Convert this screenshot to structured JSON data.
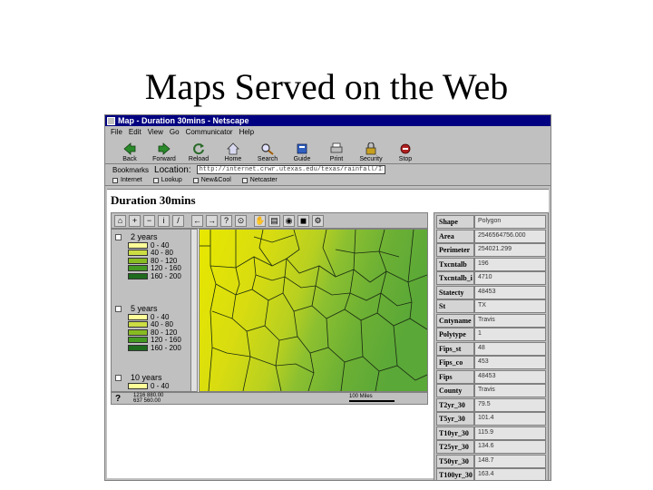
{
  "slide": {
    "title": "Maps Served on the Web"
  },
  "window": {
    "title": "Map - Duration 30mins - Netscape"
  },
  "menu": [
    "File",
    "Edit",
    "View",
    "Go",
    "Communicator",
    "Help"
  ],
  "toolbar": [
    {
      "label": "Back",
      "icon": "back-arrow-icon"
    },
    {
      "label": "Forward",
      "icon": "forward-arrow-icon"
    },
    {
      "label": "Reload",
      "icon": "reload-icon"
    },
    {
      "label": "Home",
      "icon": "home-icon"
    },
    {
      "label": "Search",
      "icon": "search-icon"
    },
    {
      "label": "Guide",
      "icon": "guide-icon"
    },
    {
      "label": "Print",
      "icon": "printer-icon"
    },
    {
      "label": "Security",
      "icon": "lock-icon"
    },
    {
      "label": "Stop",
      "icon": "stop-icon"
    }
  ],
  "location": {
    "bookmarks_label": "Bookmarks",
    "label": "Location:",
    "url": "http://internet.crwr.utexas.edu/texas/rainfall/IDF.htm"
  },
  "personal_toolbar": [
    "Internet",
    "Lookup",
    "New&Cool",
    "Netcaster"
  ],
  "page": {
    "heading": "Duration 30mins"
  },
  "map_tools": [
    "⌂",
    "+",
    "−",
    "i",
    "/",
    "←",
    "→",
    "?",
    "⊙",
    "✋",
    "▤",
    "◉",
    "◼",
    "⚙"
  ],
  "legend": {
    "colors": [
      "#ffff99",
      "#ccdd44",
      "#88bb22",
      "#449922",
      "#1e6b1e"
    ],
    "groups": [
      {
        "title": "2 years",
        "ranges": [
          "0 - 40",
          "40 - 80",
          "80 - 120",
          "120 - 160",
          "160 - 200"
        ]
      },
      {
        "title": "5 years",
        "ranges": [
          "0 - 40",
          "40 - 80",
          "80 - 120",
          "120 - 160",
          "160 - 200"
        ]
      },
      {
        "title": "10 years",
        "ranges": [
          "0 - 40"
        ]
      }
    ]
  },
  "statusbar": {
    "help": "?",
    "coords_line1": "1216 880.00",
    "coords_line2": "637 560.00",
    "scale": "100 Miles"
  },
  "attributes": [
    {
      "key": "Shape",
      "value": "Polygon"
    },
    {
      "key": "Area",
      "value": "2546564756.000"
    },
    {
      "key": "Perimeter",
      "value": "254021.299"
    },
    {
      "key": "Txcntalb",
      "value": "196"
    },
    {
      "key": "Txcntalb_i",
      "value": "4710"
    },
    {
      "key": "Statecty",
      "value": "48453"
    },
    {
      "key": "St",
      "value": "TX"
    },
    {
      "key": "Cntyname",
      "value": "Travis"
    },
    {
      "key": "Polytype",
      "value": "1"
    },
    {
      "key": "Fips_st",
      "value": "48"
    },
    {
      "key": "Fips_co",
      "value": "453"
    },
    {
      "key": "Fips",
      "value": "48453"
    },
    {
      "key": "County",
      "value": "Travis"
    },
    {
      "key": "T2yr_30",
      "value": "79.5"
    },
    {
      "key": "T5yr_30",
      "value": "101.4"
    },
    {
      "key": "T10yr_30",
      "value": "115.9"
    },
    {
      "key": "T25yr_30",
      "value": "134.6"
    },
    {
      "key": "T50yr_30",
      "value": "148.7"
    },
    {
      "key": "T100yr_30",
      "value": "163.4"
    }
  ]
}
